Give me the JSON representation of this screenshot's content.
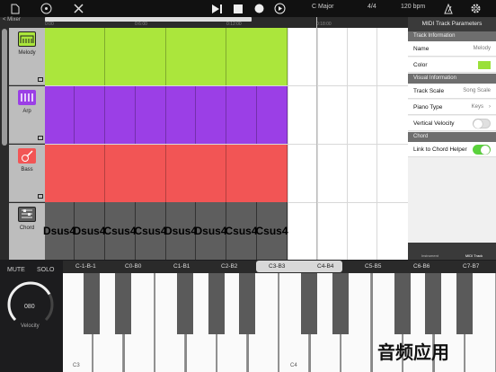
{
  "toolbar": {
    "key": "C Major",
    "time_signature": "4/4",
    "tempo": "120 bpm"
  },
  "ruler": {
    "ticks": [
      "0:00",
      "0:6:00",
      "0:12:00",
      "0:18:00"
    ]
  },
  "mixer": {
    "label": "< Mixer"
  },
  "tracks": [
    {
      "name": "Melody",
      "color": "#abe63c"
    },
    {
      "name": "Arp",
      "color": "#9b3fe6"
    },
    {
      "name": "Bass",
      "color": "#f25555"
    },
    {
      "name": "Chord",
      "color": "#5e5e5e"
    }
  ],
  "chords": [
    "Dsus4",
    "Dsus4",
    "Csus4",
    "Csus4",
    "Dsus4",
    "Dsus4",
    "Csus4",
    "Csus4"
  ],
  "panel": {
    "title": "MIDI Track Parameters",
    "track_info": "Track Information",
    "name_label": "Name",
    "name_value": "Melody",
    "color_label": "Color",
    "color_value": "#9ae03a",
    "visual_info": "Visual Information",
    "scale_label": "Track Scale",
    "scale_value": "Song Scale",
    "piano_label": "Piano Type",
    "piano_value": "Keys",
    "velocity_label": "Vertical Velocity",
    "chord_section": "Chord",
    "helper_label": "Link to Chord Helper",
    "tab1": "Instrument",
    "tab2": "MIDI Track"
  },
  "controls": {
    "mute": "MUTE",
    "solo": "SOLO",
    "velocity_value": "080",
    "velocity_label": "Velocity"
  },
  "keyboard": {
    "ranges": [
      "C-1-B-1",
      "C0-B0",
      "C1-B1",
      "C2-B2",
      "C3-B3",
      "C4-B4",
      "C5-B5",
      "C6-B6",
      "C7-B7"
    ],
    "selected_range": "C3-B3",
    "label_c3": "C3",
    "label_c4": "C4"
  },
  "watermark": "音频应用"
}
